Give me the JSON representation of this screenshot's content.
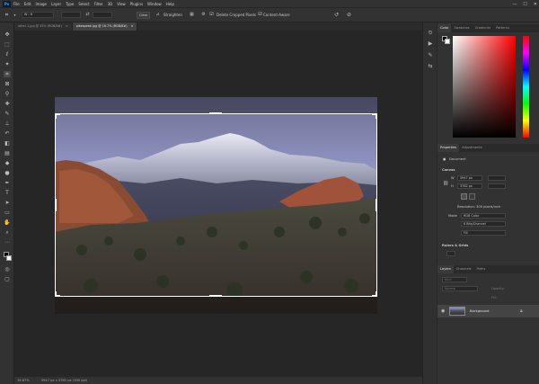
{
  "app": {
    "logo": "Ps"
  },
  "menu": [
    "File",
    "Edit",
    "Image",
    "Layer",
    "Type",
    "Select",
    "Filter",
    "3D",
    "View",
    "Plugins",
    "Window",
    "Help"
  ],
  "window_controls": {
    "minimize": "—",
    "maximize": "☐",
    "close": "✕"
  },
  "options_bar": {
    "ratio_value": "W : H",
    "clear_label": "Clear",
    "straighten_label": "Straighten",
    "delete_cropped_label": "Delete Cropped Pixels",
    "content_aware_label": "Content-Aware"
  },
  "tabs": [
    {
      "label": "other 1.jpg @ 33% (RGB/8#)",
      "active": false
    },
    {
      "label": "pikespeak.jpg @ 16.7% (RGB/8#)",
      "active": true
    }
  ],
  "status": {
    "zoom": "16.67%",
    "doc_info": "5947 px x 3782 px (300 ppi)"
  },
  "color_panel": {
    "tabs": [
      "Color",
      "Swatches",
      "Gradients",
      "Patterns"
    ],
    "active": "Color"
  },
  "properties_panel": {
    "tabs": [
      "Properties",
      "Adjustments"
    ],
    "active": "Properties",
    "doc_label": "Document",
    "canvas_header": "Canvas",
    "width_value": "5947 px",
    "height_value": "3782 px",
    "x_placeholder": "X",
    "y_placeholder": "Y",
    "resolution": "Resolution: 300 pixels/inch",
    "mode_label": "Mode",
    "mode_value": "RGB Color",
    "bits_value": "8 Bits/Channel",
    "fill_value": "Fill",
    "rulers_header": "Rulers & Grids"
  },
  "layers_panel": {
    "tabs": [
      "Layers",
      "Channels",
      "Paths"
    ],
    "active": "Layers",
    "layer_name": "Background",
    "kind_placeholder": "Kind",
    "blend_mode": "Normal",
    "opacity_label": "Opacity:",
    "fill_label": "Fill:"
  },
  "colors": {
    "accent": "#31a8ff",
    "panel": "#323232",
    "workspace": "#262626"
  }
}
